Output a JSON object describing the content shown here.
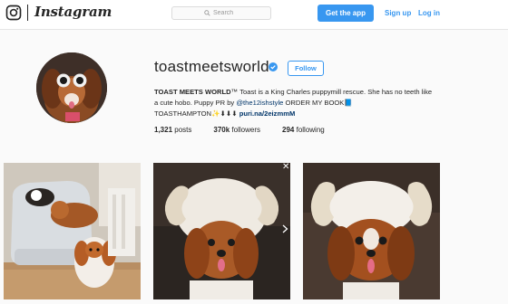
{
  "header": {
    "brand": "Instagram",
    "search_placeholder": "Search",
    "get_app_label": "Get the app",
    "signup_label": "Sign up",
    "login_label": "Log in",
    "icons": [
      "instagram-logo-icon",
      "search-icon"
    ]
  },
  "profile": {
    "username": "toastmeetsworld",
    "verified": true,
    "follow_label": "Follow",
    "bio": {
      "name": "TOAST MEETS WORLD",
      "tm": "™",
      "line1": " Toast is a King Charles puppymill rescue. She has no teeth like a cute hobo. Puppy PR by ",
      "mention": "@the12ishstyle",
      "line2": " ORDER MY BOOK",
      "book_glyph": "📘",
      "line3": "TOASTHAMPTON",
      "line3_glyphs": "✨⬇⬇⬇",
      "link": "puri.na/2eizmmM"
    },
    "stats": {
      "posts_count": "1,321",
      "posts_label": "posts",
      "followers_count": "370k",
      "followers_label": "followers",
      "following_count": "294",
      "following_label": "following"
    }
  },
  "posts": [
    {
      "subject": "two dogs on grey armchair"
    },
    {
      "subject": "dog in white lamb costume hat with curled horns"
    },
    {
      "subject": "dog in white lamb costume close-up"
    }
  ],
  "overlay": {
    "close_glyph": "✕"
  },
  "colors": {
    "accent": "#3897f0",
    "link_dark": "#003569",
    "text": "#262626",
    "bg": "#fafafa"
  }
}
